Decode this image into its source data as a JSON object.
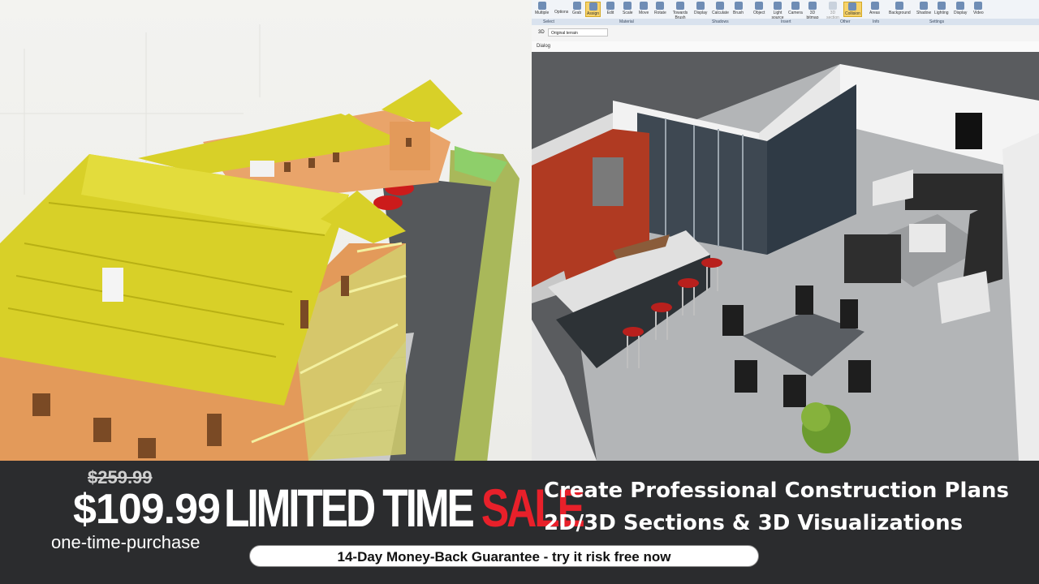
{
  "ribbon": {
    "buttons": [
      {
        "label": "Multiple",
        "icon": "select-icon"
      },
      {
        "label": "Options",
        "icon": "options-icon"
      },
      {
        "label": "Grab",
        "icon": "grab-icon"
      },
      {
        "label": "Assign",
        "icon": "assign-icon",
        "active": true
      },
      {
        "label": "Edit",
        "icon": "edit-icon"
      },
      {
        "label": "Scale",
        "icon": "scale-icon"
      },
      {
        "label": "Move",
        "icon": "move-icon"
      },
      {
        "label": "Rotate",
        "icon": "rotate-icon"
      },
      {
        "label": "Towards Brush",
        "icon": "brush-icon"
      },
      {
        "label": "Display",
        "icon": "display-icon"
      },
      {
        "label": "Calculate",
        "icon": "calculate-icon"
      },
      {
        "label": "Brush",
        "icon": "brush-icon"
      },
      {
        "label": "Object",
        "icon": "object-icon"
      },
      {
        "label": "Light source",
        "icon": "light-icon"
      },
      {
        "label": "Camera",
        "icon": "camera-icon"
      },
      {
        "label": "3D bitmap",
        "icon": "bitmap-icon"
      },
      {
        "label": "3D section",
        "icon": "section-icon"
      },
      {
        "label": "Collision",
        "icon": "collision-icon",
        "active": true
      },
      {
        "label": "Areas",
        "icon": "areas-icon"
      },
      {
        "label": "Background",
        "icon": "background-icon"
      },
      {
        "label": "Shadow",
        "icon": "shadow-icon"
      },
      {
        "label": "Lighting",
        "icon": "lighting-icon"
      },
      {
        "label": "Display",
        "icon": "display-icon"
      },
      {
        "label": "Video",
        "icon": "video-icon"
      }
    ],
    "groups": [
      "Select",
      "Material",
      "Shadows",
      "Insert",
      "Other",
      "Info",
      "Settings"
    ]
  },
  "viewbar": {
    "mode": "3D",
    "terrain": "Original terrain"
  },
  "dialog": {
    "label": "Dialog"
  },
  "promo": {
    "old_price": "$259.99",
    "price": "$109.99",
    "purchase_note": "one-time-purchase",
    "headline_main": "LIMITED TIME",
    "headline_sale": "SALE",
    "tagline_1": "Create Professional Construction Plans",
    "tagline_2": "2D/3D Sections & 3D Visualizations",
    "guarantee": "14-Day Money-Back Guarantee - try it risk free now"
  },
  "colors": {
    "roof": "#d8d028",
    "wall": "#e6a068",
    "road": "#55585b",
    "sale_red": "#e8202a",
    "banner": "#2b2c2e",
    "kitchen_red": "#b03a22"
  }
}
